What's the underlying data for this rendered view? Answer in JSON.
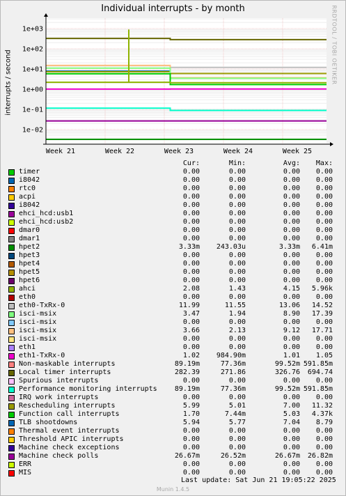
{
  "title": "Individual interrupts - by month",
  "watermark": "RRDTOOL / TOBI OETIKER",
  "footer": {
    "last_update": "Last update:  Sat Jun 21 19:05:22 2025",
    "version": "Munin 1.4.5"
  },
  "table_header": {
    "cur": "Cur:",
    "min": "Min:",
    "avg": "Avg:",
    "max": "Max:"
  },
  "chart_data": {
    "type": "line",
    "ylabel": "interrupts / second",
    "yscale": "log",
    "yticks": [
      "1e+03",
      "1e+02",
      "1e+01",
      "1e+00",
      "1e-01",
      "1e-02"
    ],
    "xticks": [
      "Week 21",
      "Week 22",
      "Week 23",
      "Week 24",
      "Week 25"
    ],
    "grid": true,
    "series": [
      {
        "name": "timer",
        "color": "#00cc00",
        "cur": "0.00",
        "min": "0.00",
        "avg": "0.00",
        "max": "0.00"
      },
      {
        "name": "i8042",
        "color": "#0066b3",
        "cur": "0.00",
        "min": "0.00",
        "avg": "0.00",
        "max": "0.00"
      },
      {
        "name": "rtc0",
        "color": "#ff8000",
        "cur": "0.00",
        "min": "0.00",
        "avg": "0.00",
        "max": "0.00"
      },
      {
        "name": "acpi",
        "color": "#ffcc00",
        "cur": "0.00",
        "min": "0.00",
        "avg": "0.00",
        "max": "0.00"
      },
      {
        "name": "i8042",
        "color": "#330099",
        "cur": "0.00",
        "min": "0.00",
        "avg": "0.00",
        "max": "0.00"
      },
      {
        "name": "ehci_hcd:usb1",
        "color": "#990099",
        "cur": "0.00",
        "min": "0.00",
        "avg": "0.00",
        "max": "0.00"
      },
      {
        "name": "ehci_hcd:usb2",
        "color": "#ccff00",
        "cur": "0.00",
        "min": "0.00",
        "avg": "0.00",
        "max": "0.00"
      },
      {
        "name": "dmar0",
        "color": "#ff0000",
        "cur": "0.00",
        "min": "0.00",
        "avg": "0.00",
        "max": "0.00"
      },
      {
        "name": "dmar1",
        "color": "#808080",
        "cur": "0.00",
        "min": "0.00",
        "avg": "0.00",
        "max": "0.00"
      },
      {
        "name": "hpet2",
        "color": "#008f00",
        "cur": "3.33m",
        "min": "243.03u",
        "avg": "3.33m",
        "max": "6.41m"
      },
      {
        "name": "hpet3",
        "color": "#00487d",
        "cur": "0.00",
        "min": "0.00",
        "avg": "0.00",
        "max": "0.00"
      },
      {
        "name": "hpet4",
        "color": "#b35a00",
        "cur": "0.00",
        "min": "0.00",
        "avg": "0.00",
        "max": "0.00"
      },
      {
        "name": "hpet5",
        "color": "#b38f00",
        "cur": "0.00",
        "min": "0.00",
        "avg": "0.00",
        "max": "0.00"
      },
      {
        "name": "hpet6",
        "color": "#6b006b",
        "cur": "0.00",
        "min": "0.00",
        "avg": "0.00",
        "max": "0.00"
      },
      {
        "name": "ahci",
        "color": "#8fb300",
        "cur": "2.08",
        "min": "1.43",
        "avg": "4.15",
        "max": "5.96k"
      },
      {
        "name": "eth0",
        "color": "#b30000",
        "cur": "0.00",
        "min": "0.00",
        "avg": "0.00",
        "max": "0.00"
      },
      {
        "name": "eth0-TxRx-0",
        "color": "#bebebe",
        "cur": "11.99",
        "min": "11.55",
        "avg": "13.06",
        "max": "14.52"
      },
      {
        "name": "isci-msix",
        "color": "#80ff80",
        "cur": "3.47",
        "min": "1.94",
        "avg": "8.90",
        "max": "17.39"
      },
      {
        "name": "isci-msix",
        "color": "#80c9ff",
        "cur": "0.00",
        "min": "0.00",
        "avg": "0.00",
        "max": "0.00"
      },
      {
        "name": "isci-msix",
        "color": "#ffc080",
        "cur": "3.66",
        "min": "2.13",
        "avg": "9.12",
        "max": "17.71"
      },
      {
        "name": "isci-msix",
        "color": "#ffe680",
        "cur": "0.00",
        "min": "0.00",
        "avg": "0.00",
        "max": "0.00"
      },
      {
        "name": "eth1",
        "color": "#aa80ff",
        "cur": "0.00",
        "min": "0.00",
        "avg": "0.00",
        "max": "0.00"
      },
      {
        "name": "eth1-TxRx-0",
        "color": "#ee00cc",
        "cur": "1.02",
        "min": "984.90m",
        "avg": "1.01",
        "max": "1.05"
      },
      {
        "name": "Non-maskable interrupts",
        "color": "#ff8080",
        "cur": "89.19m",
        "min": "77.36m",
        "avg": "99.52m",
        "max": "591.85m"
      },
      {
        "name": "Local timer interrupts",
        "color": "#666600",
        "cur": "282.39",
        "min": "271.86",
        "avg": "326.76",
        "max": "694.74"
      },
      {
        "name": "Spurious interrupts",
        "color": "#ffbfff",
        "cur": "0.00",
        "min": "0.00",
        "avg": "0.00",
        "max": "0.00"
      },
      {
        "name": "Performance monitoring interrupts",
        "color": "#00ffcc",
        "cur": "89.19m",
        "min": "77.36m",
        "avg": "99.52m",
        "max": "591.85m"
      },
      {
        "name": "IRQ work interrupts",
        "color": "#cc6699",
        "cur": "0.00",
        "min": "0.00",
        "avg": "0.00",
        "max": "0.00"
      },
      {
        "name": "Rescheduling interrupts",
        "color": "#999900",
        "cur": "5.99",
        "min": "5.01",
        "avg": "7.00",
        "max": "11.32"
      },
      {
        "name": "Function call interrupts",
        "color": "#00cc00",
        "cur": "1.70",
        "min": "7.44m",
        "avg": "5.03",
        "max": "4.37k"
      },
      {
        "name": "TLB shootdowns",
        "color": "#0066b3",
        "cur": "5.94",
        "min": "5.77",
        "avg": "7.04",
        "max": "8.79"
      },
      {
        "name": "Thermal event interrupts",
        "color": "#ff8000",
        "cur": "0.00",
        "min": "0.00",
        "avg": "0.00",
        "max": "0.00"
      },
      {
        "name": "Threshold APIC interrupts",
        "color": "#ffcc00",
        "cur": "0.00",
        "min": "0.00",
        "avg": "0.00",
        "max": "0.00"
      },
      {
        "name": "Machine check exceptions",
        "color": "#330099",
        "cur": "0.00",
        "min": "0.00",
        "avg": "0.00",
        "max": "0.00"
      },
      {
        "name": "Machine check polls",
        "color": "#990099",
        "cur": "26.67m",
        "min": "26.52m",
        "avg": "26.67m",
        "max": "26.82m"
      },
      {
        "name": "ERR",
        "color": "#ccff00",
        "cur": "0.00",
        "min": "0.00",
        "avg": "0.00",
        "max": "0.00"
      },
      {
        "name": "MIS",
        "color": "#ff0000",
        "cur": "0.00",
        "min": "0.00",
        "avg": "0.00",
        "max": "0.00"
      }
    ],
    "plotted_lines": [
      {
        "label": "Local timer interrupts",
        "color": "#666600",
        "before": 326.76,
        "after": 282.39
      },
      {
        "label": "eth0-TxRx-0",
        "color": "#bebebe",
        "before": 14.52,
        "after": 11.99
      },
      {
        "label": "isci-msix",
        "color": "#ffc080",
        "before": 15.0,
        "after": 3.66
      },
      {
        "label": "TLB shootdowns",
        "color": "#0066b3",
        "before": 7.8,
        "after": 5.94
      },
      {
        "label": "Rescheduling interrupts",
        "color": "#999900",
        "before": 7.3,
        "after": 5.99
      },
      {
        "label": "isci-msix",
        "color": "#80ff80",
        "before": 11.0,
        "after": 3.47
      },
      {
        "label": "Function call interrupts",
        "color": "#00cc00",
        "before": 5.8,
        "after": 1.7
      },
      {
        "label": "ahci",
        "color": "#8fb300",
        "before": 2.2,
        "after": 2.08
      },
      {
        "label": "eth1-TxRx-0",
        "color": "#ee00cc",
        "before": 1.01,
        "after": 1.02
      },
      {
        "label": "Performance monitoring interrupts",
        "color": "#00ffcc",
        "before": 0.115,
        "after": 0.089
      },
      {
        "label": "Machine check polls",
        "color": "#990099",
        "before": 0.0267,
        "after": 0.0267
      },
      {
        "label": "hpet2",
        "color": "#008f00",
        "before": 0.0033,
        "after": 0.0033
      }
    ],
    "spike": {
      "label": "ahci",
      "x_week": 22.4,
      "value": 900
    }
  }
}
